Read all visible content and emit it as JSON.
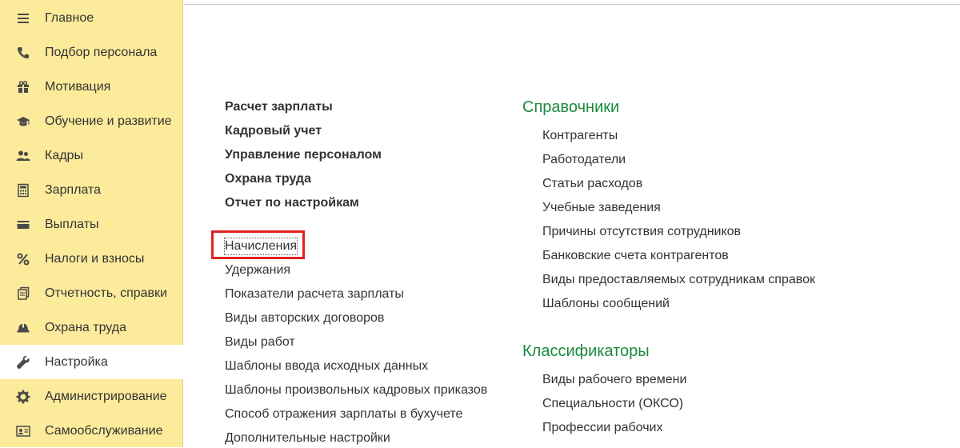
{
  "sidebar": {
    "items": [
      {
        "label": "Главное",
        "icon": "menu-list-icon"
      },
      {
        "label": "Подбор персонала",
        "icon": "phone-icon"
      },
      {
        "label": "Мотивация",
        "icon": "gift-icon"
      },
      {
        "label": "Обучение и развитие",
        "icon": "graduation-cap-icon"
      },
      {
        "label": "Кадры",
        "icon": "people-icon"
      },
      {
        "label": "Зарплата",
        "icon": "calculator-icon"
      },
      {
        "label": "Выплаты",
        "icon": "card-icon"
      },
      {
        "label": "Налоги и взносы",
        "icon": "percent-icon"
      },
      {
        "label": "Отчетность, справки",
        "icon": "documents-icon"
      },
      {
        "label": "Охрана труда",
        "icon": "hard-hat-icon"
      },
      {
        "label": "Настройка",
        "icon": "wrench-icon",
        "active": true
      },
      {
        "label": "Администрирование",
        "icon": "gear-icon"
      },
      {
        "label": "Самообслуживание",
        "icon": "id-card-icon"
      }
    ]
  },
  "main": {
    "bold_links": [
      "Расчет зарплаты",
      "Кадровый учет",
      "Управление персоналом",
      "Охрана труда",
      "Отчет по настройкам"
    ],
    "links": [
      "Начисления",
      "Удержания",
      "Показатели расчета зарплаты",
      "Виды авторских договоров",
      "Виды работ",
      "Шаблоны ввода исходных данных",
      "Шаблоны произвольных кадровых приказов",
      "Способ отражения зарплаты в бухучете",
      "Дополнительные настройки"
    ],
    "handbooks": {
      "title": "Справочники",
      "items": [
        "Контрагенты",
        "Работодатели",
        "Статьи расходов",
        "Учебные заведения",
        "Причины отсутствия сотрудников",
        "Банковские счета контрагентов",
        "Виды предоставляемых сотрудникам справок",
        "Шаблоны сообщений"
      ]
    },
    "classifiers": {
      "title": "Классификаторы",
      "items": [
        "Виды рабочего времени",
        "Специальности (ОКСО)",
        "Профессии рабочих"
      ]
    }
  },
  "colors": {
    "sidebar_bg": "#fdeb9c",
    "section_title": "#1b8a3c",
    "highlight": "#e02020"
  }
}
